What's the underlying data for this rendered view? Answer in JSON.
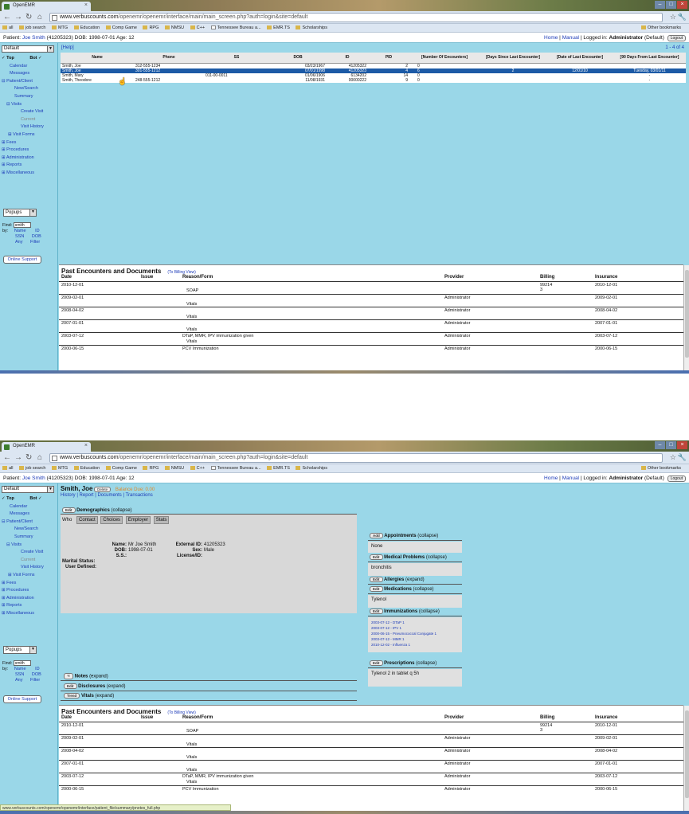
{
  "browser": {
    "tab_title": "OpenEMR",
    "url_host": "www.verbuscounts.com",
    "url_path": "/openemr/openemr/interface/main/main_screen.php?auth=login&site=default",
    "bookmarks": [
      "all",
      "job search",
      "MTG",
      "Education",
      "Comp Game",
      "RPG",
      "NMSU",
      "C++",
      "Tennessee Bureau a...",
      "EMR.TS",
      "Scholarships"
    ],
    "other_bookmarks": "Other bookmarks",
    "status_url": "www.verbuscounts.com/openemr/openemr/interface/patient_file/summary/pnotes_full.php"
  },
  "patient_bar": {
    "label": "Patient:",
    "name": "Joe Smith",
    "info": "(41205323) DOB: 1998-07-01 Age: 12",
    "home": "Home",
    "manual": "Manual",
    "logged_in": "Logged in:",
    "user": "Administrator",
    "group": "(Default)",
    "logout": "Logout"
  },
  "sidebar": {
    "select": "Default",
    "top": "Top",
    "bot": "Bot",
    "items": [
      "Calendar",
      "Messages",
      "Patient/Client",
      "New/Search",
      "Summary",
      "Visits",
      "Create Visit",
      "Current",
      "Visit History",
      "Visit Forms",
      "Fees",
      "Procedures",
      "Administration",
      "Reports",
      "Miscellaneous"
    ],
    "popups": "Popups",
    "find_label": "Find:",
    "find_value": "smith",
    "by_label": "by:",
    "by_row1": [
      "Name",
      "ID"
    ],
    "by_row2": [
      "SSN",
      "DOB"
    ],
    "by_row3": [
      "Any",
      "Filter"
    ],
    "support": "Online Support"
  },
  "finder": {
    "help": "[Help]",
    "count": "1 - 4 of 4",
    "columns": [
      "Name",
      "Phone",
      "SS",
      "DOB",
      "ID",
      "PID",
      "[Number Of Encounters]",
      "[Days Since Last Encounter]",
      "[Date of Last Encounter]",
      "[90 Days From Last Encounter]"
    ],
    "rows": [
      [
        "Smith, Joe",
        "312-555-1234",
        "",
        "03/23/1967",
        "41205322",
        "2",
        "0",
        "",
        "",
        ""
      ],
      [
        "Smith, Joe",
        "301-555-1212",
        "",
        "07/01/1998",
        "41205323",
        "4",
        "6",
        "2",
        "12/01/10",
        "Tuesday, 03/01/11"
      ],
      [
        "Smith, Mary",
        "",
        "011-00-0011",
        "01/06/1906",
        "6134202",
        "14",
        "0",
        "",
        "",
        "-"
      ],
      [
        "Smith, Theodore",
        "248-555-1212",
        "",
        "11/08/1931",
        "00000222",
        "9",
        "0",
        "",
        "",
        "-"
      ]
    ]
  },
  "encounters": {
    "title": "Past Encounters and Documents",
    "to_billing": "(To Billing View)",
    "columns": [
      "Date",
      "Issue",
      "Reason/Form",
      "Provider",
      "Billing",
      "Insurance"
    ],
    "rows": [
      {
        "date": "2010-12-01",
        "reason": "",
        "form": "SOAP",
        "provider": "",
        "billing": "99214",
        "billing2": "3",
        "insurance": "2010-12-01"
      },
      {
        "date": "2009-02-01",
        "reason": "",
        "form": "Vitals",
        "provider": "Administrator",
        "billing": "",
        "billing2": "",
        "insurance": "2009-02-01"
      },
      {
        "date": "2008-04-02",
        "reason": "",
        "form": "Vitals",
        "provider": "Administrator",
        "billing": "",
        "billing2": "",
        "insurance": "2008-04-02"
      },
      {
        "date": "2007-01-01",
        "reason": "",
        "form": "Vitals",
        "provider": "Administrator",
        "billing": "",
        "billing2": "",
        "insurance": "2007-01-01"
      },
      {
        "date": "2003-07-12",
        "reason": "DTaP, MMR, IPV immunization given",
        "form": "Vitals",
        "provider": "Administrator",
        "billing": "",
        "billing2": "",
        "insurance": "2003-07-12"
      },
      {
        "date": "2000-06-15",
        "reason": "PCV Immunization",
        "form": "",
        "provider": "Administrator",
        "billing": "",
        "billing2": "",
        "insurance": "2000-06-15"
      }
    ]
  },
  "summary": {
    "name": "Smith, Joe",
    "delete": "Delete",
    "balance": "Balance Due: 0.00",
    "links": "History | Report | Documents | Transactions",
    "edit": "Edit",
    "add": "Add",
    "trend": "Trend",
    "demographics": "Demographics",
    "collapse": "(collapse)",
    "expand": "(expand)",
    "demo_tabs": [
      "Who",
      "Contact",
      "Choices",
      "Employer",
      "Stats"
    ],
    "name_label": "Name:",
    "name_value": "Mr Joe Smith",
    "dob_label": "DOB:",
    "dob_value": "1998-07-01",
    "ss_label": "S.S.:",
    "ext_id_label": "External ID:",
    "ext_id_value": "41205323",
    "sex_label": "Sex:",
    "sex_value": "Male",
    "license_label": "License/ID:",
    "marital_label": "Marital Status:",
    "user_defined_label": "User Defined:",
    "notes": "Notes",
    "disclosures": "Disclosures",
    "vitals": "Vitals",
    "appointments": "Appointments",
    "appointments_value": "None",
    "medical_problems": "Medical Problems",
    "medical_problems_value": "bronchitis",
    "allergies": "Allergies",
    "medications": "Medications",
    "medications_value": "Tylenol",
    "immunizations": "Immunizations",
    "immunization_items": [
      "2003-07-12 - DTaP 1",
      "2003-07-12 - IPV 1",
      "2000-06-15 - Pneumococcal Conjugate 1",
      "2003-07-12 - MMR 1",
      "2010-12-02 - Influenza 1"
    ],
    "prescriptions": "Prescriptions",
    "prescriptions_value": "Tylenol 2 in tablet q 5h"
  }
}
